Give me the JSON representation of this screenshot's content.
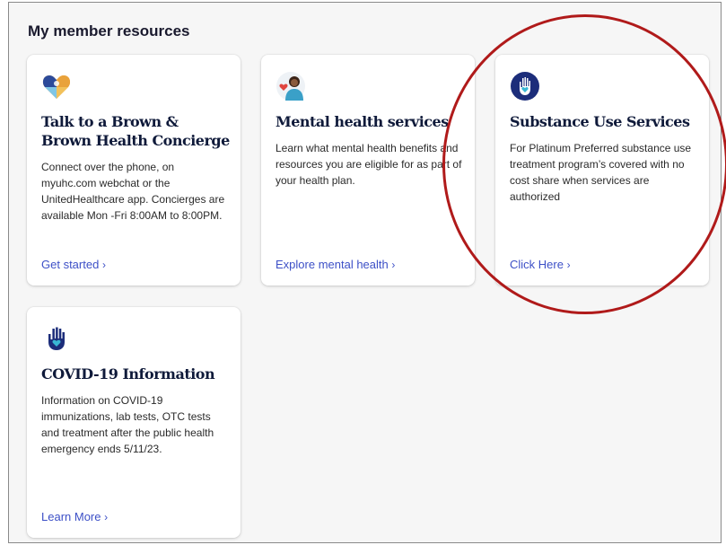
{
  "section_title": "My member resources",
  "cards": [
    {
      "icon": "puzzle-heart-icon",
      "title": "Talk to a Brown & Brown Health Concierge",
      "description": "Connect over the phone, on myuhc.com webchat or the UnitedHealthcare app. Concierges are available Mon -Fri 8:00AM to 8:00PM.",
      "link": "Get started"
    },
    {
      "icon": "person-heart-icon",
      "title": "Mental health services",
      "description": "Learn what mental health benefits and resources you are eligible for as part of your health plan.",
      "link": "Explore mental health"
    },
    {
      "icon": "hand-heart-icon",
      "title": "Substance Use Services",
      "description": "For Platinum Preferred substance use treatment program’s covered with no cost share when services are authorized",
      "link": "Click Here"
    },
    {
      "icon": "hand-heart-icon",
      "title": "COVID-19 Information",
      "description": "Information on COVID-19 immunizations, lab tests, OTC tests and treatment after the public health emergency ends 5/11/23.",
      "link": "Learn More"
    }
  ],
  "colors": {
    "link": "#3d50c7",
    "navy": "#1c2d7a",
    "heart": "#39b7d4",
    "annotation_circle": "#b01a1a"
  }
}
